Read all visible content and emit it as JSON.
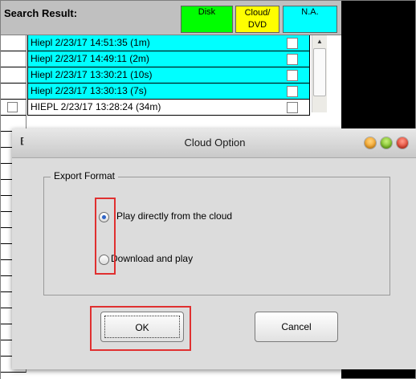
{
  "search_panel": {
    "title": "Search Result:",
    "legend": {
      "disk": "Disk",
      "cloud_line1": "Cloud/",
      "cloud_line2": "DVD",
      "na": "N.A."
    },
    "rows": [
      {
        "label": "Hiepl 2/23/17 14:51:35 (1m)",
        "highlight": "cyan"
      },
      {
        "label": "Hiepl 2/23/17 14:49:11 (2m)",
        "highlight": "cyan"
      },
      {
        "label": "Hiepl 2/23/17 13:30:21 (10s)",
        "highlight": "cyan"
      },
      {
        "label": "Hiepl 2/23/17 13:30:13 (7s)",
        "highlight": "cyan"
      },
      {
        "label": "HIEPL 2/23/17 13:28:24 (34m)",
        "highlight": "white"
      }
    ],
    "colors": {
      "disk": "#00ff00",
      "cloud": "#ffff00",
      "na": "#00ffff",
      "row_cyan": "#00ffff"
    }
  },
  "dialog": {
    "title": "Cloud Option",
    "group_label": "Export Format",
    "options": [
      {
        "label": "Play directly from the cloud",
        "selected": true
      },
      {
        "label": "Download and play",
        "selected": false
      }
    ],
    "ok_label": "OK",
    "cancel_label": "Cancel",
    "icons": {
      "app": "app-icon",
      "minimize": "orange-window-button",
      "maximize": "green-window-button",
      "close": "red-window-button"
    },
    "annotation_color": "#e03030"
  }
}
